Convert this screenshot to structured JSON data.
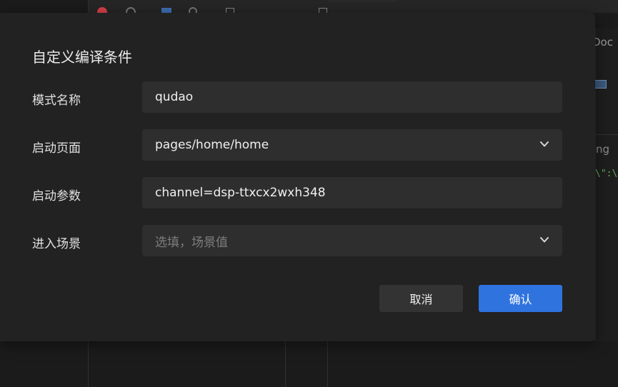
{
  "background": {
    "doc_text": "Doc",
    "ng_text": "ng",
    "code_text": "\\\":\\"
  },
  "dialog": {
    "title": "自定义编译条件",
    "fields": [
      {
        "label": "模式名称",
        "value": "qudao",
        "type": "input"
      },
      {
        "label": "启动页面",
        "value": "pages/home/home",
        "type": "select"
      },
      {
        "label": "启动参数",
        "value": "channel=dsp-ttxcx2wxh348",
        "type": "input"
      },
      {
        "label": "进入场景",
        "placeholder": "选填，场景值",
        "type": "select"
      }
    ],
    "cancel_label": "取消",
    "confirm_label": "确认"
  },
  "colors": {
    "dialog_bg": "#222222",
    "field_bg": "#2e2e2e",
    "primary": "#2f73df"
  }
}
